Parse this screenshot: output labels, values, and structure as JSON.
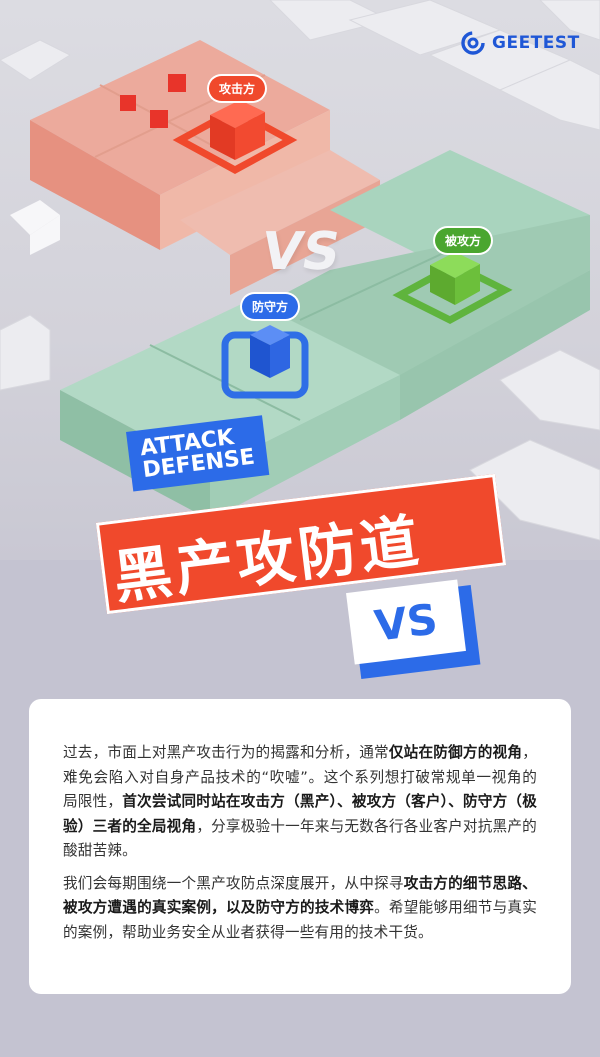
{
  "brand": {
    "name": "GEETEST",
    "icon": "geetest-logo-icon"
  },
  "tags": {
    "attacker": "攻击方",
    "victim": "被攻方",
    "defender": "防守方"
  },
  "scene_vs": "VS",
  "title": {
    "en_line1": "ATTACK",
    "en_line2": "DEFENSE",
    "cn": "黑产攻防道",
    "vs": "VS"
  },
  "colors": {
    "attack_red": "#f0492c",
    "defense_blue": "#2c6be8",
    "victim_green": "#4aa62f",
    "background": "#c4c3d1"
  },
  "intro": {
    "p1": [
      {
        "text": "过去，市面上对黑产攻击行为的揭露和分析，通常",
        "bold": false
      },
      {
        "text": "仅站在防御方的视角",
        "bold": true
      },
      {
        "text": "，难免会陷入对自身产品技术的“吹嘘”。这个系列想打破常规单一视角的局限性，",
        "bold": false
      },
      {
        "text": "首次尝试同时站在攻击方（黑产）、被攻方（客户）、防守方（极验）三者的全局视角",
        "bold": true
      },
      {
        "text": "，分享极验十一年来与无数各行各业客户对抗黑产的酸甜苦辣。",
        "bold": false
      }
    ],
    "p2": [
      {
        "text": "我们会每期围绕一个黑产攻防点深度展开，从中探寻",
        "bold": false
      },
      {
        "text": "攻击方的细节思路、被攻方遭遇的真实案例，以及防守方的技术博弈",
        "bold": true
      },
      {
        "text": "。希望能够用细节与真实的案例，帮助业务安全从业者获得一些有用的技术干货。",
        "bold": false
      }
    ]
  }
}
